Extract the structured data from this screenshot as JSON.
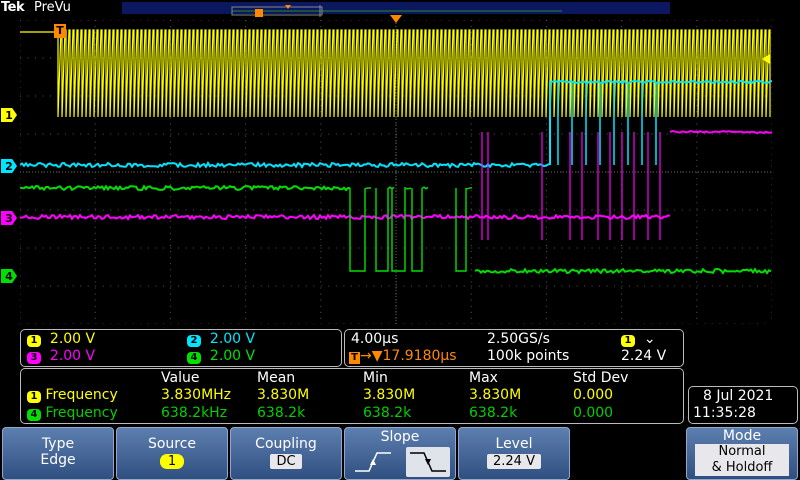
{
  "brand": "Tek",
  "mode": "PreVu",
  "trigger_marker": "T",
  "channels": [
    {
      "id": "1",
      "color": "#ffff00"
    },
    {
      "id": "2",
      "color": "#00e5ff"
    },
    {
      "id": "3",
      "color": "#ff00ff"
    },
    {
      "id": "4",
      "color": "#00e000"
    }
  ],
  "vertical": {
    "ch1": {
      "num": "1",
      "value": "2.00 V"
    },
    "ch2": {
      "num": "2",
      "value": "2.00 V"
    },
    "ch3": {
      "num": "3",
      "value": "2.00 V"
    },
    "ch4": {
      "num": "4",
      "value": "2.00 V"
    }
  },
  "horizontal": {
    "scale": "4.00µs",
    "sample_rate": "2.50GS/s",
    "trigger_pos": "17.9180µs",
    "record_length": "100k points",
    "trig_channel": "1",
    "trig_level": "2.24 V",
    "trig_slope_symbol": "⌄"
  },
  "measurements": {
    "headers": [
      "Value",
      "Mean",
      "Min",
      "Max",
      "Std Dev"
    ],
    "rows": [
      {
        "ch": "1",
        "name": "Frequency",
        "value": "3.830MHz",
        "mean": "3.830M",
        "min": "3.830M",
        "max": "3.830M",
        "std": "0.000"
      },
      {
        "ch": "4",
        "name": "Frequency",
        "value": "638.2kHz",
        "mean": "638.2k",
        "min": "638.2k",
        "max": "638.2k",
        "std": "0.000"
      }
    ]
  },
  "datetime": {
    "date": "8 Jul  2021",
    "time": "11:35:28"
  },
  "menu": {
    "type_label": "Type",
    "type_value": "Edge",
    "source_label": "Source",
    "source_value": "1",
    "coupling_label": "Coupling",
    "coupling_value": "DC",
    "slope_label": "Slope",
    "level_label": "Level",
    "level_value": "2.24 V",
    "mode_label": "Mode",
    "mode_value": "Normal",
    "mode_value2": "& Holdoff"
  }
}
